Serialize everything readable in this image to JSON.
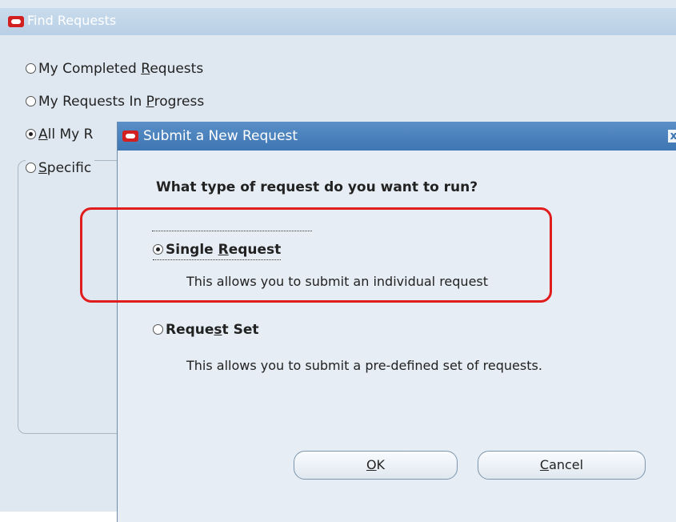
{
  "bg_window": {
    "title": "Find Requests",
    "options": [
      {
        "pre": "My Completed ",
        "u": "R",
        "post": "equests",
        "checked": false
      },
      {
        "pre": "My Requests In ",
        "u": "P",
        "post": "rogress",
        "checked": false
      },
      {
        "pre": "",
        "u": "A",
        "post": "ll My R",
        "checked": true
      },
      {
        "pre": "",
        "u": "S",
        "post": "pecific",
        "checked": false
      }
    ]
  },
  "dialog": {
    "title": "Submit a New Request",
    "close_symbol": "x",
    "question": "What type of request do you want to run?",
    "single": {
      "pre": "Single ",
      "u": "R",
      "post": "equest",
      "desc": "This allows you to submit an individual request",
      "checked": true
    },
    "set": {
      "pre": "Reque",
      "u": "s",
      "post": "t Set",
      "desc": "This allows you to submit a pre-defined set of requests.",
      "checked": false
    },
    "ok": {
      "u": "O",
      "post": "K"
    },
    "cancel": {
      "u": "C",
      "post": "ancel"
    }
  },
  "colors": {
    "highlight": "#e11c1c",
    "titlebar": "#3e76b3",
    "logo": "#d21f1f"
  }
}
